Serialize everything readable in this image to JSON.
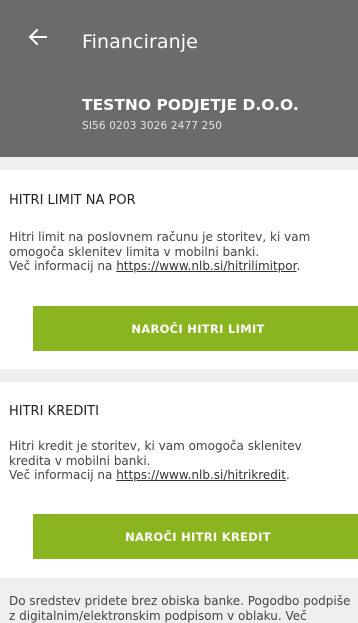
{
  "header": {
    "title": "Financiranje",
    "back_icon": "arrow-left-icon"
  },
  "account": {
    "name": "TESTNO PODJETJE D.O.O.",
    "iban": "SI56 0203 3026 2477 250"
  },
  "hitri_limit": {
    "title": "HITRI LIMIT NA POR",
    "desc_line1": "Hitri limit na poslovnem računu je storitev, ki vam",
    "desc_line2": "omogoča sklenitev limita v mobilni banki.",
    "desc_line3_prefix": "Več informacij na ",
    "link": "https://www.nlb.si/hitrilimitpor",
    "desc_line3_suffix": ".",
    "button_label": "NAROČI HITRI LIMIT"
  },
  "hitri_krediti": {
    "title": "HITRI KREDITI",
    "desc_line1": "Hitri kredit je storitev, ki vam omogoča sklenitev",
    "desc_line2": "kredita v mobilni banki.",
    "desc_line3_prefix": "Več informacij na ",
    "link": "https://www.nlb.si/hitrikredit",
    "desc_line3_suffix": ".",
    "button_label": "NAROČI HITRI KREDIT"
  },
  "footer": {
    "line1": "Do sredstev pridete brez obiska banke. Pogodbo podpiše",
    "line2": "z digitalnim/elektronskim podpisom v oblaku. Več"
  },
  "colors": {
    "header_bg": "#6b6b6b",
    "accent_button": "#8ab420",
    "page_bg": "#efefef"
  }
}
